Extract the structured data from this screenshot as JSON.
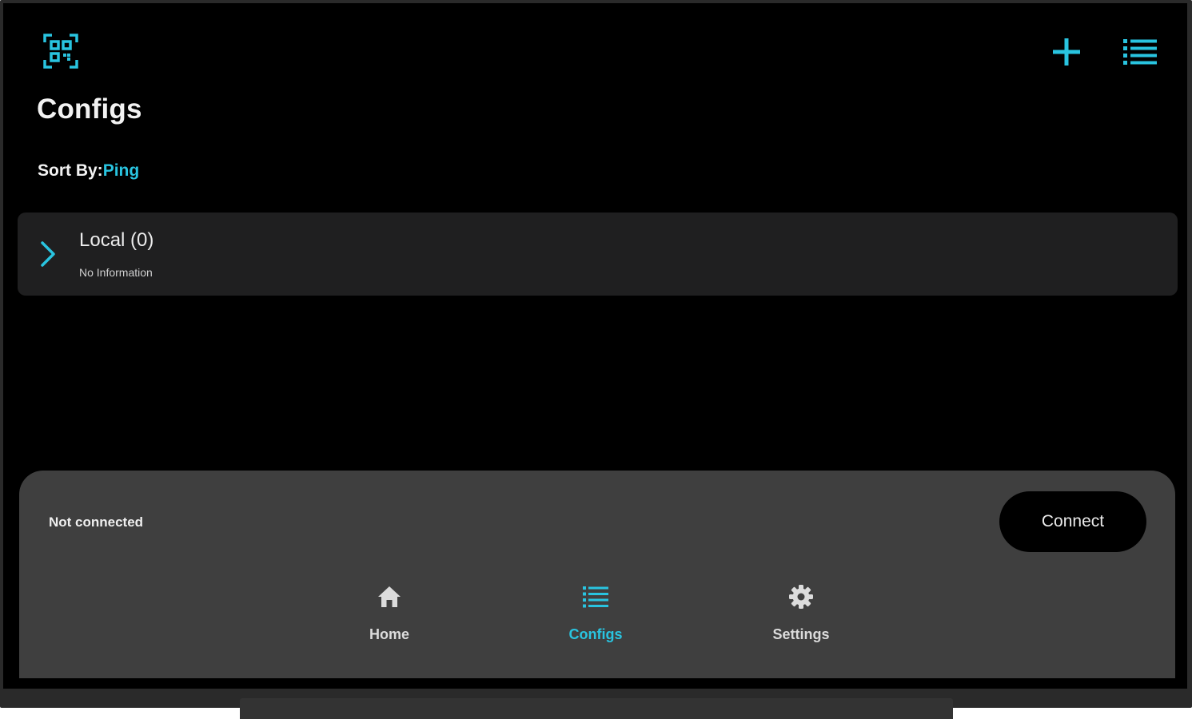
{
  "header": {
    "title": "Configs",
    "qr_icon": "qr-scan-icon",
    "add_icon": "plus-icon",
    "list_icon": "list-icon"
  },
  "sort": {
    "label": "Sort By:",
    "value": "Ping"
  },
  "groups": [
    {
      "name": "Local (0)",
      "info": "No Information"
    }
  ],
  "connection": {
    "status": "Not connected",
    "button_label": "Connect"
  },
  "nav": {
    "items": [
      {
        "label": "Home",
        "icon": "home-icon",
        "active": false
      },
      {
        "label": "Configs",
        "icon": "list-icon",
        "active": true
      },
      {
        "label": "Settings",
        "icon": "gear-icon",
        "active": false
      }
    ]
  },
  "colors": {
    "accent": "#29c4e0",
    "background": "#000000",
    "card": "#1f1f20",
    "panel": "#3f3f3f"
  }
}
